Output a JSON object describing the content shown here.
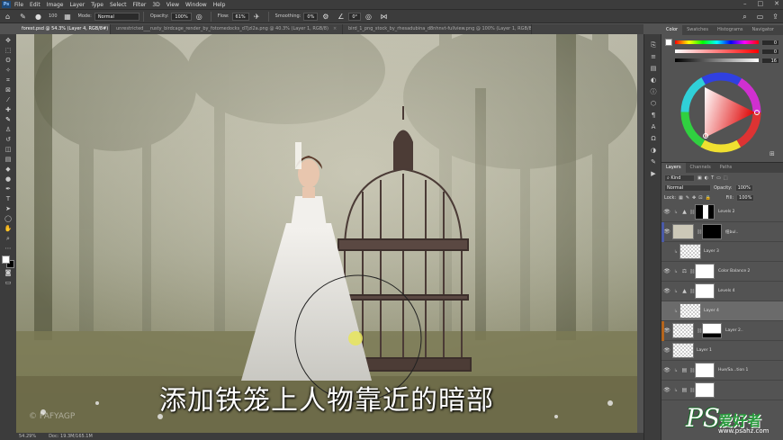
{
  "menubar": {
    "logo": "Ps",
    "items": [
      "File",
      "Edit",
      "Image",
      "Layer",
      "Type",
      "Select",
      "Filter",
      "3D",
      "View",
      "Window",
      "Help"
    ],
    "window_controls": [
      "–",
      "□",
      "✕"
    ]
  },
  "options": {
    "brush_size": "100",
    "mode_label": "Mode:",
    "mode_value": "Normal",
    "opacity_label": "Opacity:",
    "opacity_value": "100%",
    "flow_label": "Flow:",
    "flow_value": "61%",
    "smoothing_label": "Smoothing:",
    "smoothing_value": "0%",
    "angle_value": "0°"
  },
  "tabs": [
    {
      "label": "forest.psd @ 54.3% (Layer 4, RGB/8#) *",
      "active": true
    },
    {
      "label": "unrestricted___rusty_birdcage_render_by_fotomedocks_d7jzl2a.png @ 40.3% (Layer 1, RGB/8)",
      "active": false
    },
    {
      "label": "bird_1_png_stock_by_rhesadubina_d8nhnvt-fullview.png @ 100% (Layer 1, RGB/8)",
      "active": false
    }
  ],
  "status": {
    "zoom": "54.29%",
    "doc": "Doc: 19.3M/165.1M"
  },
  "canvas": {
    "subtitle": "添加铁笼上人物靠近的暗部",
    "watermark_left": "© PAFYAGP"
  },
  "color_panel": {
    "tabs": [
      "Color",
      "Swatches",
      "Histograms",
      "Navigator"
    ],
    "values": [
      "0",
      "0",
      "16"
    ]
  },
  "layers_panel": {
    "tabs": [
      "Layers",
      "Channels",
      "Paths"
    ],
    "filter": "Kind",
    "blend_mode": "Normal",
    "opacity_label": "Opacity:",
    "opacity_value": "100%",
    "lock_label": "Lock:",
    "fill_label": "Fill:",
    "fill_value": "100%",
    "layers": [
      {
        "name": "Levels 2",
        "type": "adjust",
        "clipped": true,
        "mask": "black-white"
      },
      {
        "name": "纽bul..",
        "type": "smart",
        "clipped": false,
        "mask": "black-white",
        "color_label": "#4a5aa8"
      },
      {
        "name": "Layer 3",
        "type": "pixel",
        "clipped": true
      },
      {
        "name": "Color Balance 2",
        "type": "adjust",
        "clipped": true,
        "mask": "white"
      },
      {
        "name": "Levels 4",
        "type": "adjust",
        "clipped": true,
        "mask": "white"
      },
      {
        "name": "Layer 4",
        "type": "pixel",
        "clipped": true,
        "selected": true
      },
      {
        "name": "Layer 2..",
        "type": "smart",
        "clipped": false,
        "mask": "shape",
        "color_label": "#b5651d"
      },
      {
        "name": "Layer 1",
        "type": "pixel",
        "clipped": false
      },
      {
        "name": "Hue/Sa...tion 1",
        "type": "adjust",
        "clipped": true,
        "mask": "white"
      },
      {
        "name": "",
        "type": "adjust",
        "clipped": true,
        "mask": "white"
      }
    ]
  },
  "watermark": {
    "ps": "PS",
    "cn": "爱好者",
    "url": "www.psahz.com"
  }
}
